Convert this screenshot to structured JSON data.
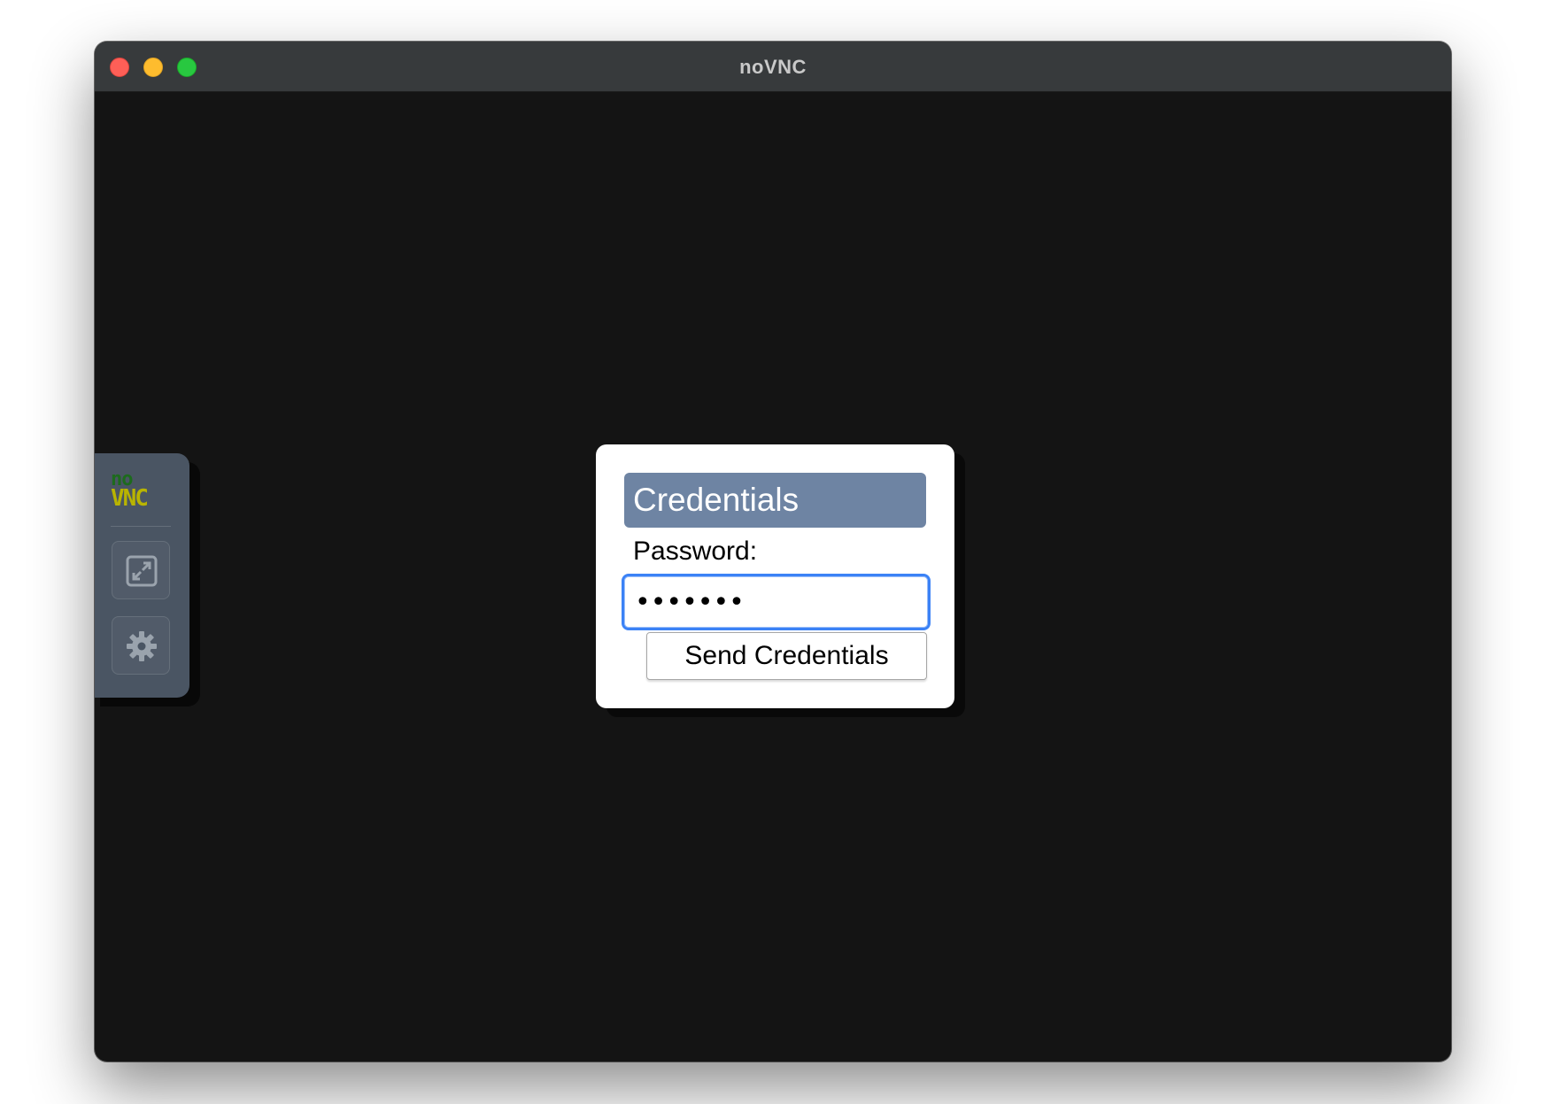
{
  "window": {
    "title": "noVNC"
  },
  "control_bar": {
    "logo_top": "no",
    "logo_bottom": "VNC",
    "buttons": [
      {
        "icon": "fullscreen-icon"
      },
      {
        "icon": "gear-icon"
      }
    ]
  },
  "credentials_dialog": {
    "title": "Credentials",
    "password_label": "Password:",
    "password_value": "•••••••",
    "send_button_label": "Send Credentials"
  },
  "colors": {
    "dialog_header": "#6e84a3",
    "control_bar": "#4a5563",
    "input_focus": "#3b82f6",
    "background": "#141414"
  }
}
